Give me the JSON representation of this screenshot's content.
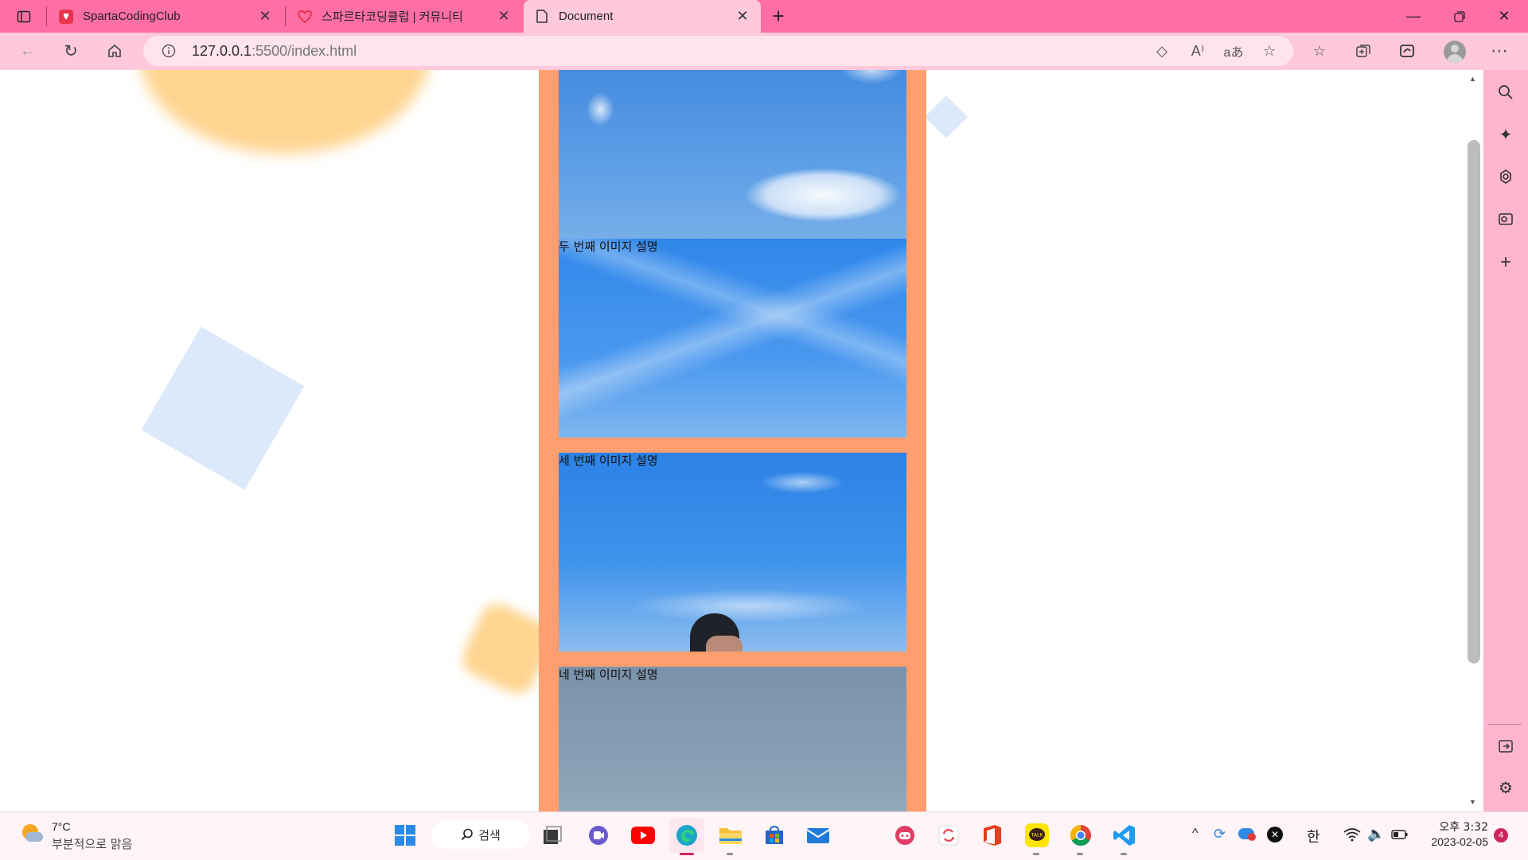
{
  "browser": {
    "tabs": [
      {
        "title": "SpartaCodingClub",
        "active": false
      },
      {
        "title": "스파르타코딩클럽 | 커뮤니티",
        "active": false
      },
      {
        "title": "Document",
        "active": true
      }
    ],
    "address": {
      "host": "127.0.0.1",
      "rest": ":5500/index.html"
    }
  },
  "page": {
    "cards": [
      {
        "caption": ""
      },
      {
        "caption": "두 번째 이미지 설명"
      },
      {
        "caption": "세 번째 이미지 설명"
      },
      {
        "caption": "네 번째 이미지 설명"
      }
    ]
  },
  "taskbar": {
    "weather_temp": "7°C",
    "weather_desc": "부분적으로 맑음",
    "search_label": "검색",
    "ime": "한",
    "time": "오후 3:32",
    "date": "2023-02-05",
    "notification_count": "4"
  },
  "colors": {
    "tabstrip": "#ff6fa3",
    "toolbar": "#ffc9db",
    "sidebar": "#ffb5cf",
    "column": "#ff9e6e",
    "deco_orange": "#ffd48f",
    "deco_blue": "#dce9fb"
  },
  "icons": [
    "tab-actions-icon",
    "back-icon",
    "refresh-icon",
    "home-icon",
    "site-info-icon",
    "tracking-prevention-icon",
    "read-aloud-icon",
    "translate-icon",
    "favorite-add-icon",
    "favorites-icon",
    "collections-icon",
    "browser-essentials-icon",
    "profile-icon",
    "more-icon",
    "search-icon",
    "copilot-icon",
    "shopping-icon",
    "outlook-icon",
    "add-icon",
    "sidebar-toggle-icon",
    "settings-icon"
  ]
}
